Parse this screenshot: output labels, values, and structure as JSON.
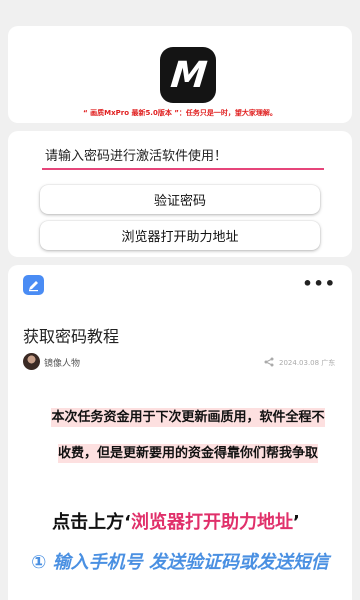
{
  "header": {
    "logo_letter": "M",
    "notice": "“ 画质MxPro 最新5.0版本 ”：任务只是一时，望大家理解。"
  },
  "form": {
    "password_placeholder": "请输入密码进行激活软件使用！",
    "password_value": "",
    "verify_label": "验证密码",
    "browser_label": "浏览器打开助力地址"
  },
  "article": {
    "app_icon": "edit-note-icon",
    "more_icon": "•••",
    "title": "获取密码教程",
    "author": "镜像人物",
    "date": "2024.03.08 广东",
    "para1": "本次任务资金用于下次更新画质用，软件全程不",
    "para2": "收费，但是更新要用的资金得靠你们帮我争取",
    "big_prefix": "点击上方‘",
    "big_highlight": "浏览器打开助力地址",
    "big_suffix": "’",
    "step_line": "① 输入手机号 发送验证码或发送短信"
  },
  "colors": {
    "background": "#f0f0f0",
    "notice_red": "#e02020",
    "input_underline": "#e6457a",
    "highlight_pink": "#e0306a",
    "step_blue": "#4a90e2",
    "app_icon_blue": "#4a8cf4"
  }
}
